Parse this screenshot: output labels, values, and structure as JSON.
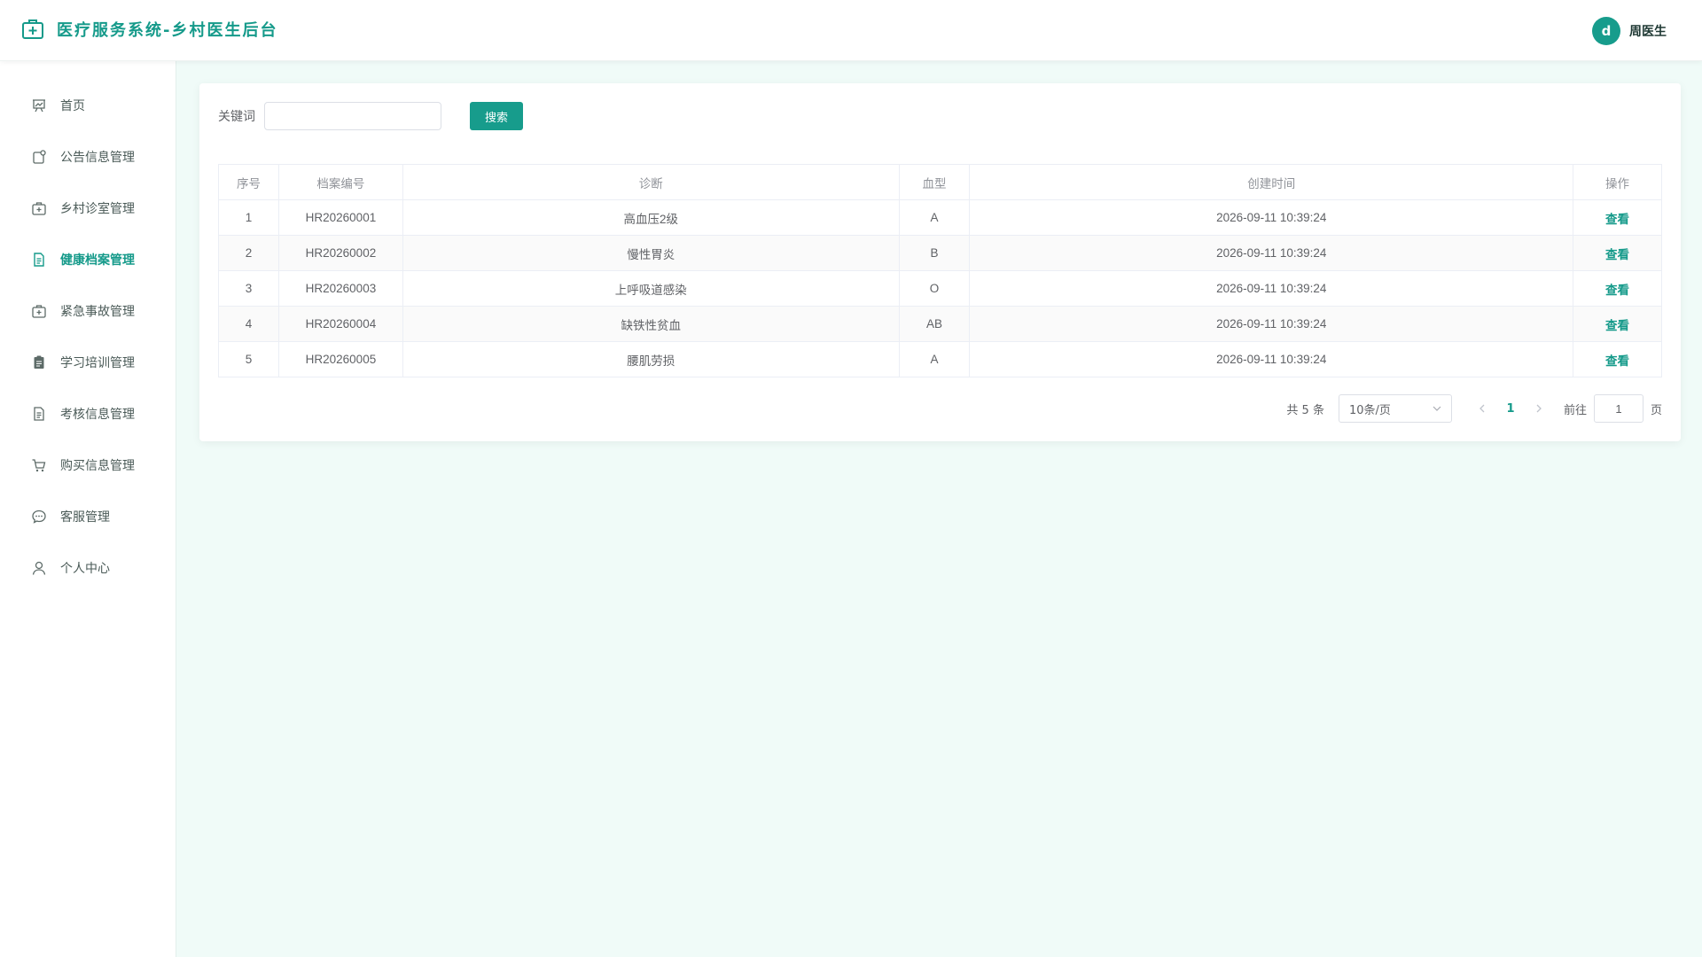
{
  "header": {
    "title": "医疗服务系统-乡村医生后台",
    "brand_icon": "medical-kit-icon",
    "user": {
      "avatar_letter": "d",
      "name": "周医生"
    }
  },
  "sidebar": {
    "items": [
      {
        "label": "首页",
        "icon": "dashboard-chart-icon",
        "active": false
      },
      {
        "label": "公告信息管理",
        "icon": "notice-icon",
        "active": false
      },
      {
        "label": "乡村诊室管理",
        "icon": "clinic-kit-icon",
        "active": false
      },
      {
        "label": "健康档案管理",
        "icon": "document-icon",
        "active": true
      },
      {
        "label": "紧急事故管理",
        "icon": "first-aid-icon",
        "active": false
      },
      {
        "label": "学习培训管理",
        "icon": "clipboard-icon",
        "active": false
      },
      {
        "label": "考核信息管理",
        "icon": "file-text-icon",
        "active": false
      },
      {
        "label": "购买信息管理",
        "icon": "cart-icon",
        "active": false
      },
      {
        "label": "客服管理",
        "icon": "chat-icon",
        "active": false
      },
      {
        "label": "个人中心",
        "icon": "user-icon",
        "active": false
      }
    ]
  },
  "search": {
    "label": "关键词",
    "value": "",
    "placeholder": "",
    "button_label": "搜索"
  },
  "table": {
    "headers": [
      "序号",
      "档案编号",
      "诊断",
      "血型",
      "创建时间",
      "操作"
    ],
    "rows": [
      {
        "index": "1",
        "code": "HR20260001",
        "diagnosis": "高血压2级",
        "blood": "A",
        "created": "2026-09-11 10:39:24",
        "action": "查看"
      },
      {
        "index": "2",
        "code": "HR20260002",
        "diagnosis": "慢性胃炎",
        "blood": "B",
        "created": "2026-09-11 10:39:24",
        "action": "查看"
      },
      {
        "index": "3",
        "code": "HR20260003",
        "diagnosis": "上呼吸道感染",
        "blood": "O",
        "created": "2026-09-11 10:39:24",
        "action": "查看"
      },
      {
        "index": "4",
        "code": "HR20260004",
        "diagnosis": "缺铁性贫血",
        "blood": "AB",
        "created": "2026-09-11 10:39:24",
        "action": "查看"
      },
      {
        "index": "5",
        "code": "HR20260005",
        "diagnosis": "腰肌劳损",
        "blood": "A",
        "created": "2026-09-11 10:39:24",
        "action": "查看"
      }
    ]
  },
  "pagination": {
    "total_text": "共 5 条",
    "page_size": "10条/页",
    "current_page": "1",
    "goto_label": "前往",
    "goto_value": "1",
    "page_unit": "页"
  },
  "colors": {
    "accent": "#179c8c",
    "page_bg": "#f0fbf8"
  }
}
